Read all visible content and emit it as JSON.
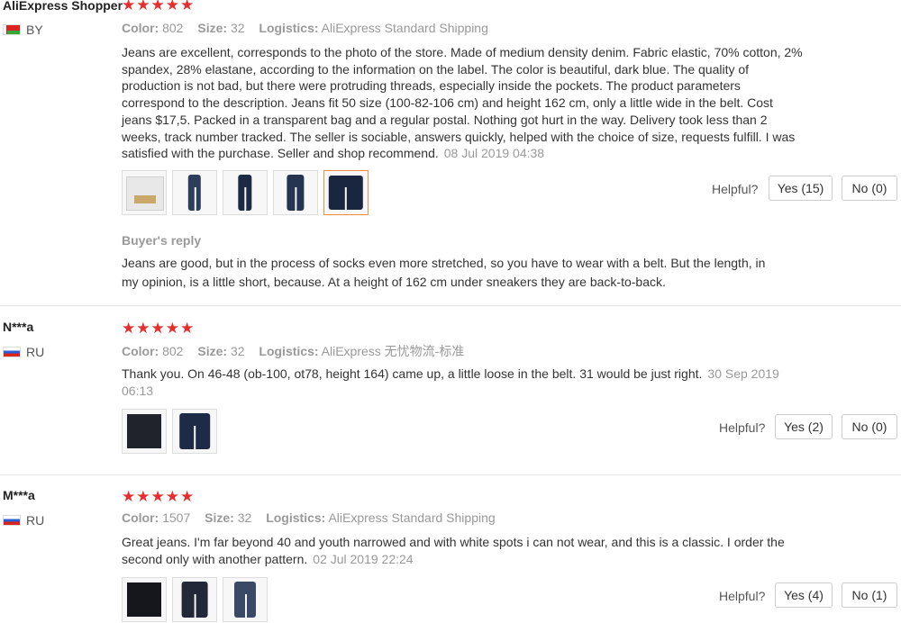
{
  "reviews": [
    {
      "user": "AliExpress Shopper",
      "country": "BY",
      "stars": "★★★★★",
      "color_label": "Color:",
      "color": "802",
      "size_label": "Size:",
      "size": "32",
      "logistics_label": "Logistics:",
      "logistics": "AliExpress Standard Shipping",
      "text": "Jeans are excellent, corresponds to the photo of the store. Made of medium density denim. Fabric elastic, 70% cotton, 2% spandex, 28% elastane, according to the information on the label. The color is beautiful, dark blue. The quality of production is not bad, but there were protruding threads, especially inside the pockets. The product parameters correspond to the description. Jeans fit 50 size (100-82-106 cm) and height 162 cm, only a little wide in the belt. Cost jeans $17,5. Packed in a transparent bag and a regular postal. Nothing got hurt in the way. Delivery took less than 2 weeks, track number tracked. The seller is sociable, answers quickly, helped with the choice of size, requests fulfill. I was satisfied with the purchase. Seller and shop recommend.",
      "date": "08 Jul 2019 04:38",
      "helpful_label": "Helpful?",
      "yes_label": "Yes (15)",
      "no_label": "No (0)",
      "reply_title": "Buyer's reply",
      "reply_text": "Jeans are good, but in the process of socks even more stretched, so you have to wear with a belt. But the length, in my opinion, is a little short, because. At a height of 162 cm under sneakers they are back-to-back."
    },
    {
      "user": "N***a",
      "country": "RU",
      "stars": "★★★★★",
      "color_label": "Color:",
      "color": "802",
      "size_label": "Size:",
      "size": "32",
      "logistics_label": "Logistics:",
      "logistics": "AliExpress 无忧物流-标准",
      "text": "Thank you. On 46-48 (ob-100, ot78, height 164) came up, a little loose in the belt. 31 would be just right.",
      "date": "30 Sep 2019 06:13",
      "helpful_label": "Helpful?",
      "yes_label": "Yes (2)",
      "no_label": "No (0)"
    },
    {
      "user": "M***a",
      "country": "RU",
      "stars": "★★★★★",
      "color_label": "Color:",
      "color": "1507",
      "size_label": "Size:",
      "size": "32",
      "logistics_label": "Logistics:",
      "logistics": "AliExpress Standard Shipping",
      "text": "Great jeans. I'm far beyond 40 and youth narrowed and with white spots i can not wear, and this is a classic. I order the second only with another pattern.",
      "date": "02 Jul 2019 22:24",
      "helpful_label": "Helpful?",
      "yes_label": "Yes (4)",
      "no_label": "No (1)"
    }
  ]
}
